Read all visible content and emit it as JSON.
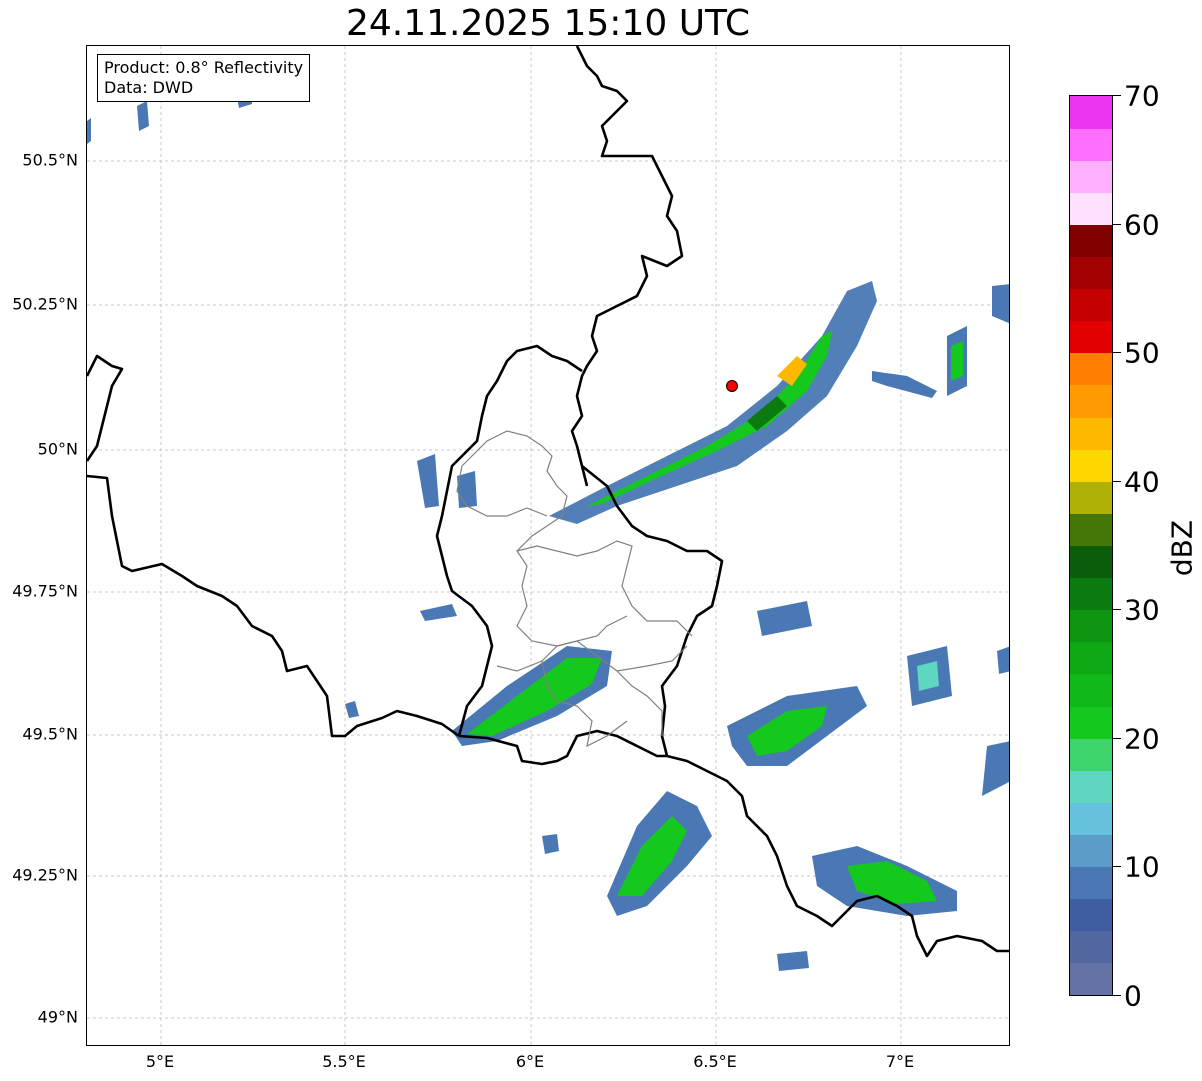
{
  "title": "24.11.2025 15:10 UTC",
  "info": {
    "product": "Product: 0.8° Reflectivity",
    "source": "Data: DWD"
  },
  "map": {
    "lon_range": [
      4.8,
      7.3
    ],
    "lat_range": [
      48.95,
      50.7
    ],
    "gridlines": true,
    "lat_ticks": [
      {
        "value": 50.5,
        "label": "50.5°N"
      },
      {
        "value": 50.25,
        "label": "50.25°N"
      },
      {
        "value": 50.0,
        "label": "50°N"
      },
      {
        "value": 49.75,
        "label": "49.75°N"
      },
      {
        "value": 49.5,
        "label": "49.5°N"
      },
      {
        "value": 49.25,
        "label": "49.25°N"
      },
      {
        "value": 49.0,
        "label": "49°N"
      }
    ],
    "lon_ticks": [
      {
        "value": 5.0,
        "label": "5°E"
      },
      {
        "value": 5.5,
        "label": "5.5°E"
      },
      {
        "value": 6.0,
        "label": "6°E"
      },
      {
        "value": 6.5,
        "label": "6.5°E"
      },
      {
        "value": 7.0,
        "label": "7°E"
      }
    ],
    "radar_site": {
      "lon": 6.55,
      "lat": 50.11,
      "color": "#ff0000"
    }
  },
  "colorbar": {
    "unit": "dBZ",
    "min": 0,
    "max": 70,
    "ticks": [
      "0",
      "10",
      "20",
      "30",
      "40",
      "50",
      "60",
      "70"
    ],
    "colors": [
      "#6473a4",
      "#52679f",
      "#415da2",
      "#4a78b4",
      "#5b9dc8",
      "#66c2dc",
      "#5ed6c0",
      "#3ed46c",
      "#14c81e",
      "#10b81a",
      "#0fa815",
      "#0e9612",
      "#0b7b0f",
      "#0a5e0a",
      "#457708",
      "#b0b106",
      "#ffd700",
      "#ffb800",
      "#ff9a00",
      "#ff7d00",
      "#e20000",
      "#c40000",
      "#a30000",
      "#800000",
      "#ffe0ff",
      "#ffb0ff",
      "#ff6eff",
      "#ec35ee"
    ]
  }
}
